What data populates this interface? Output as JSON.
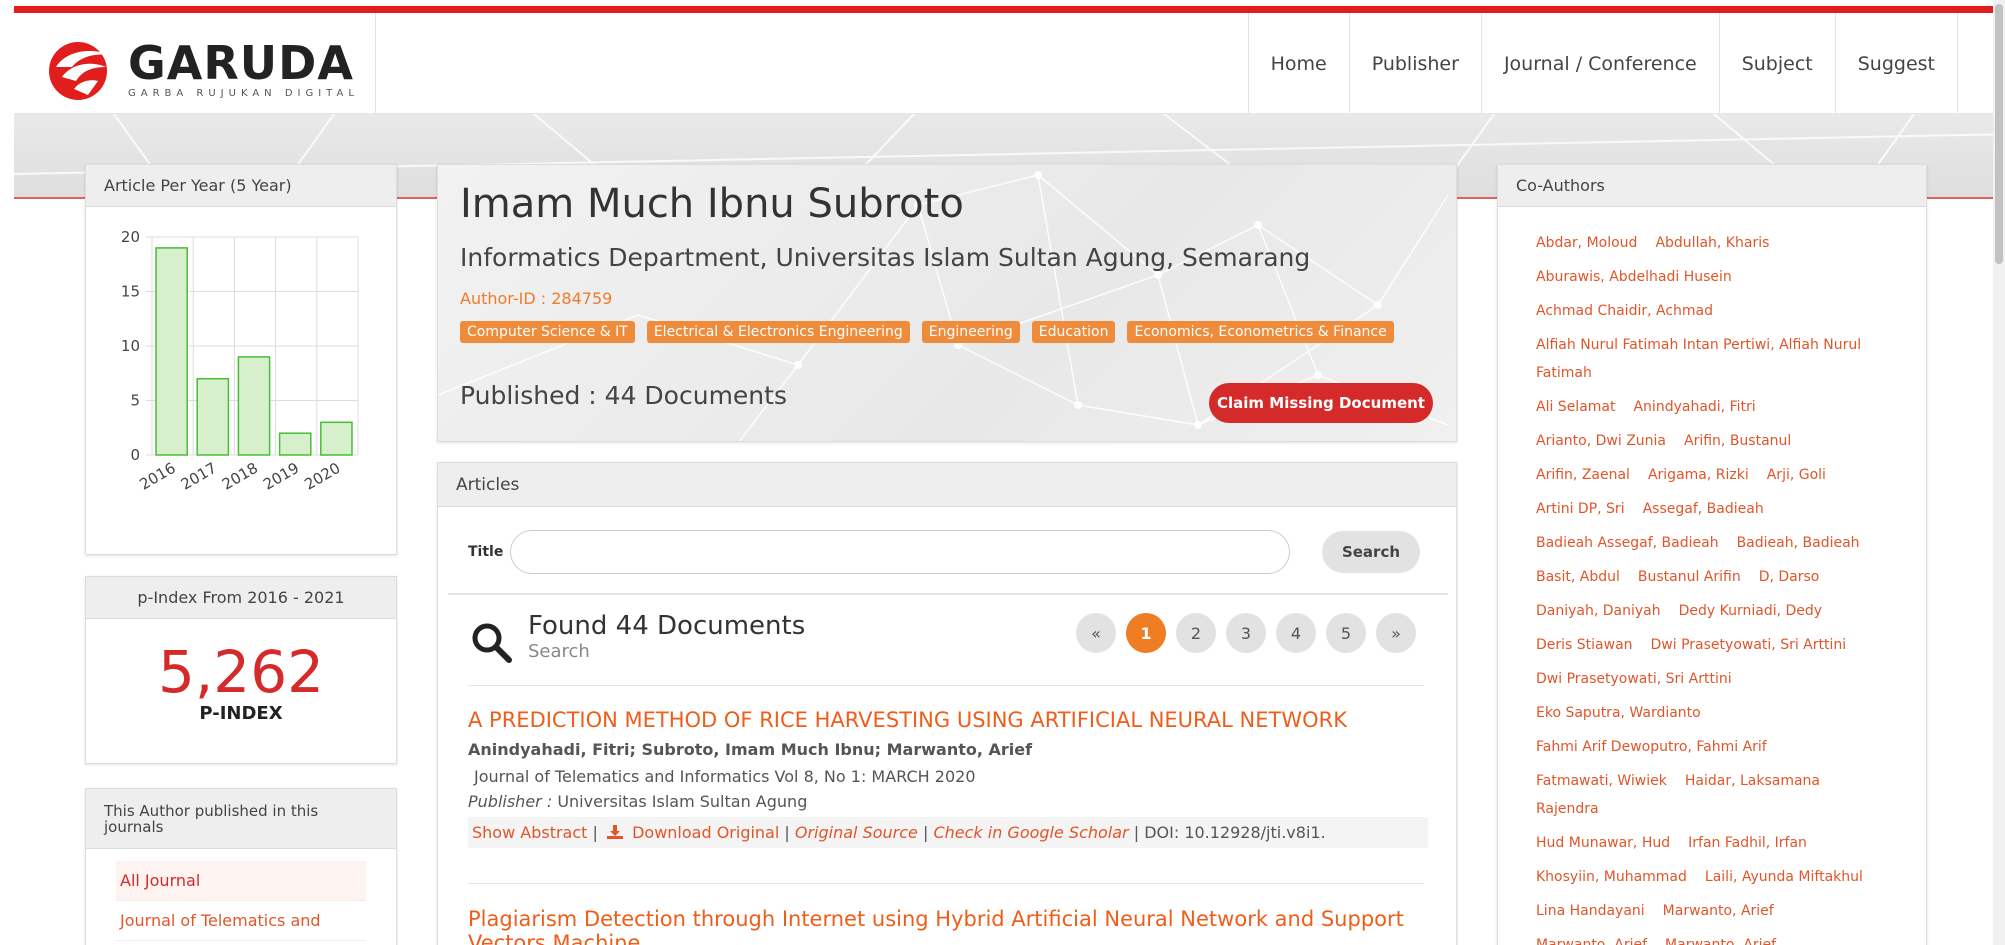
{
  "header": {
    "logo_text": "GARUDA",
    "logo_tagline": "GARBA RUJUKAN DIGITAL",
    "nav": [
      "Home",
      "Publisher",
      "Journal / Conference",
      "Subject",
      "Suggest"
    ]
  },
  "colors": {
    "accent": "#e11d1d",
    "orange": "#ef8c3c",
    "link": "#e0562a"
  },
  "left": {
    "chart_title": "Article Per Year (5 Year)",
    "pindex_title": "p-Index From 2016 - 2021",
    "pindex_value": "5,262",
    "pindex_label": "P-INDEX",
    "journals_title": "This Author published in this journals",
    "journals": [
      "All Journal",
      "Journal of Telematics and"
    ]
  },
  "chart_data": {
    "type": "bar",
    "categories": [
      "2016",
      "2017",
      "2018",
      "2019",
      "2020"
    ],
    "values": [
      19,
      7,
      9,
      2,
      3
    ],
    "yticks": [
      0,
      5,
      10,
      15,
      20
    ],
    "ylim": [
      0,
      20
    ],
    "title": "",
    "xlabel": "",
    "ylabel": "",
    "grid": true,
    "bar_color": "#d6f0cc",
    "bar_border": "#4cbb3a"
  },
  "profile": {
    "name": "Imam Much Ibnu Subroto",
    "affiliation": "Informatics Department, Universitas Islam Sultan Agung, Semarang",
    "author_id": "Author-ID : 284759",
    "tags": [
      "Computer Science & IT",
      "Electrical & Electronics Engineering",
      "Engineering",
      "Education",
      "Economics, Econometrics & Finance"
    ],
    "published": "Published : 44 Documents",
    "claim_label": "Claim Missing Document"
  },
  "articles": {
    "header": "Articles",
    "search_label": "Title",
    "search_value": "",
    "search_button": "Search",
    "found_text": "Found 44 Documents",
    "found_sub": "Search",
    "pages": [
      "«",
      "1",
      "2",
      "3",
      "4",
      "5",
      "»"
    ],
    "active_page": "1",
    "items": [
      {
        "title": "A PREDICTION METHOD OF RICE HARVESTING USING ARTIFICIAL NEURAL NETWORK",
        "authors": "Anindyahadi, Fitri; Subroto, Imam Much Ibnu; Marwanto, Arief",
        "journal": "Journal of Telematics and Informatics Vol 8, No 1: MARCH 2020",
        "publisher_label": "Publisher :",
        "publisher": "Universitas Islam Sultan Agung",
        "show_abstract": "Show Abstract",
        "download": "Download Original",
        "original_source": "Original Source",
        "scholar": "Check in Google Scholar",
        "doi": "DOI: 10.12928/jti.v8i1."
      },
      {
        "title": "Plagiarism Detection through Internet using Hybrid Artificial Neural Network and Support Vectors Machine"
      }
    ]
  },
  "coauthors": {
    "title": "Co-Authors",
    "rows": [
      [
        "Abdar, Moloud",
        "Abdullah, Kharis"
      ],
      [
        "Aburawis, Abdelhadi Husein"
      ],
      [
        "Achmad Chaidir, Achmad"
      ],
      [
        "Alfiah Nurul Fatimah Intan Pertiwi, Alfiah Nurul Fatimah"
      ],
      [
        "Ali Selamat",
        "Anindyahadi, Fitri"
      ],
      [
        "Arianto, Dwi Zunia",
        "Arifin, Bustanul"
      ],
      [
        "Arifin, Zaenal",
        "Arigama, Rizki",
        "Arji, Goli"
      ],
      [
        "Artini DP, Sri",
        "Assegaf, Badieah"
      ],
      [
        "Badieah Assegaf, Badieah",
        "Badieah, Badieah"
      ],
      [
        "Basit, Abdul",
        "Bustanul Arifin",
        "D, Darso"
      ],
      [
        "Daniyah, Daniyah",
        "Dedy Kurniadi, Dedy"
      ],
      [
        "Deris Stiawan",
        "Dwi Prasetyowati, Sri Arttini"
      ],
      [
        "Dwi Prasetyowati, Sri Arttini"
      ],
      [
        "Eko Saputra, Wardianto"
      ],
      [
        "Fahmi Arif Dewoputro, Fahmi Arif"
      ],
      [
        "Fatmawati, Wiwiek",
        "Haidar, Laksamana Rajendra"
      ],
      [
        "Hud Munawar, Hud",
        "Irfan Fadhil, Irfan"
      ],
      [
        "Khosyiin, Muhammad",
        "Laili, Ayunda Miftakhul"
      ],
      [
        "Lina Handayani",
        "Marwanto, Arief"
      ],
      [
        "Marwanto, Arief",
        "Marwanto, Arief"
      ]
    ]
  }
}
